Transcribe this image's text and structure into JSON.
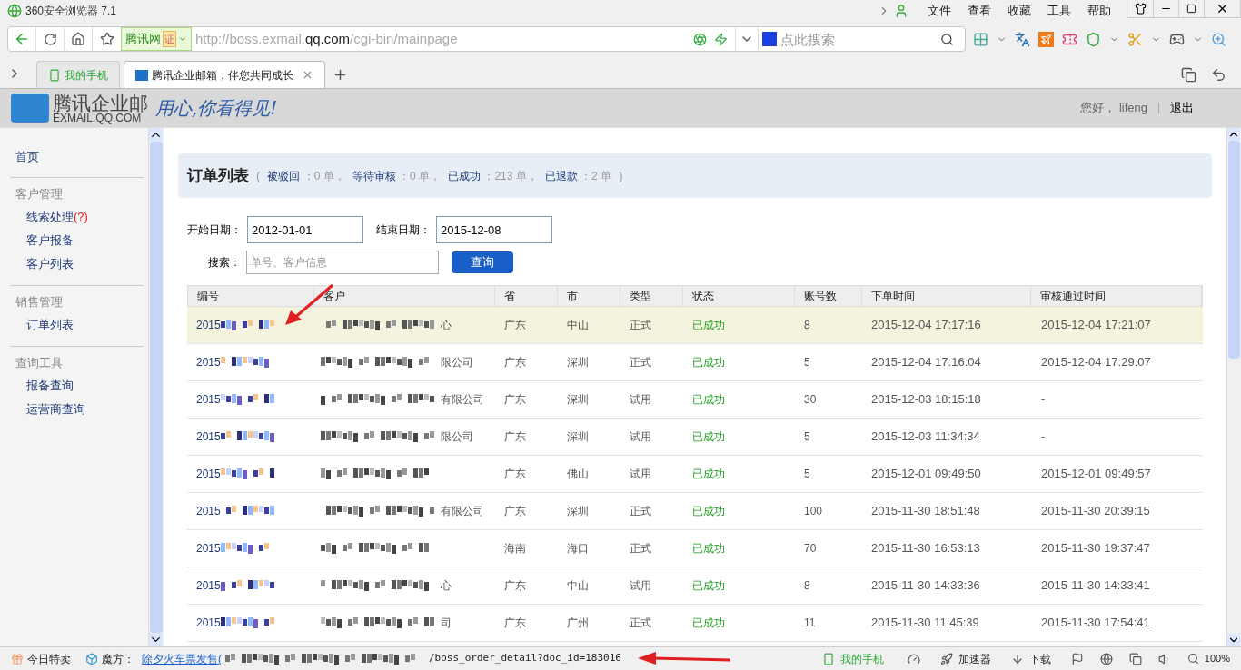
{
  "browser": {
    "title": "360安全浏览器 7.1",
    "menu": [
      "文件",
      "查看",
      "收藏",
      "工具",
      "帮助"
    ],
    "identity": {
      "name": "腾讯网",
      "badge": "证"
    },
    "url": {
      "prefix": "http://boss.exmail.",
      "domain": "qq.com",
      "path": "/cgi-bin/mainpage"
    },
    "search_placeholder": "点此搜索",
    "tabs": [
      {
        "label": "我的手机",
        "kind": "phone",
        "selected": false
      },
      {
        "label": "腾讯企业邮箱，伴您共同成长",
        "kind": "page",
        "selected": true
      }
    ]
  },
  "header": {
    "logo_name": "腾讯企业邮",
    "logo_domain": "EXMAIL.QQ.COM",
    "slogan": "用心,你看得见!",
    "greeting": "您好，",
    "user": "lifeng",
    "logout": "退出"
  },
  "sidebar": {
    "home": "首页",
    "groups": [
      {
        "title": "客户管理",
        "items": [
          {
            "label": "线索处理",
            "badge": "(?)"
          },
          {
            "label": "客户报备"
          },
          {
            "label": "客户列表"
          }
        ]
      },
      {
        "title": "销售管理",
        "items": [
          {
            "label": "订单列表"
          }
        ]
      },
      {
        "title": "查询工具",
        "items": [
          {
            "label": "报备查询"
          },
          {
            "label": "运营商查询"
          }
        ]
      }
    ]
  },
  "summary": {
    "title": "订单列表",
    "open": "(",
    "close": ")",
    "stats": [
      {
        "label": "被驳回",
        "value": "：0 单，"
      },
      {
        "label": "等待审核",
        "value": "：0 单，"
      },
      {
        "label": "已成功",
        "value": "：213 单，"
      },
      {
        "label": "已退款",
        "value": "：2 单"
      }
    ]
  },
  "filters": {
    "start_label": "开始日期：",
    "start_value": "2012-01-01",
    "end_label": "结束日期：",
    "end_value": "2015-12-08",
    "search_label": "搜索：",
    "search_placeholder": "单号、客户信息",
    "query_button": "查询"
  },
  "table": {
    "columns": [
      "编号",
      "客户",
      "省",
      "市",
      "类型",
      "状态",
      "账号数",
      "下单时间",
      "审核通过时间"
    ],
    "rows": [
      {
        "order_no": "2015",
        "customer": "心",
        "province": "广东",
        "city": "中山",
        "type": "正式",
        "status": "已成功",
        "accounts": "8",
        "order_time": "2015-12-04 17:17:16",
        "approved_time": "2015-12-04 17:21:07",
        "selected": true
      },
      {
        "order_no": "2015",
        "customer": "限公司",
        "province": "广东",
        "city": "深圳",
        "type": "正式",
        "status": "已成功",
        "accounts": "5",
        "order_time": "2015-12-04 17:16:04",
        "approved_time": "2015-12-04 17:29:07",
        "selected": false
      },
      {
        "order_no": "2015",
        "customer": "有限公司",
        "province": "广东",
        "city": "深圳",
        "type": "试用",
        "status": "已成功",
        "accounts": "30",
        "order_time": "2015-12-03 18:15:18",
        "approved_time": "-",
        "selected": false
      },
      {
        "order_no": "2015",
        "customer": "限公司",
        "province": "广东",
        "city": "深圳",
        "type": "试用",
        "status": "已成功",
        "accounts": "5",
        "order_time": "2015-12-03 11:34:34",
        "approved_time": "-",
        "selected": false
      },
      {
        "order_no": "2015",
        "province": "广东",
        "city": "佛山",
        "type": "试用",
        "status": "已成功",
        "accounts": "5",
        "order_time": "2015-12-01 09:49:50",
        "approved_time": "2015-12-01 09:49:57",
        "selected": false
      },
      {
        "order_no": "2015",
        "customer": "有限公司",
        "province": "广东",
        "city": "深圳",
        "type": "正式",
        "status": "已成功",
        "accounts": "100",
        "order_time": "2015-11-30 18:51:48",
        "approved_time": "2015-11-30 20:39:15",
        "selected": false
      },
      {
        "order_no": "2015",
        "province": "海南",
        "city": "海口",
        "type": "正式",
        "status": "已成功",
        "accounts": "70",
        "order_time": "2015-11-30 16:53:13",
        "approved_time": "2015-11-30 19:37:47",
        "selected": false
      },
      {
        "order_no": "2015",
        "customer": "心",
        "province": "广东",
        "city": "中山",
        "type": "试用",
        "status": "已成功",
        "accounts": "8",
        "order_time": "2015-11-30 14:33:36",
        "approved_time": "2015-11-30 14:33:41",
        "selected": false
      },
      {
        "order_no": "2015",
        "customer": "司",
        "province": "广东",
        "city": "广州",
        "type": "正式",
        "status": "已成功",
        "accounts": "11",
        "order_time": "2015-11-30 11:45:39",
        "approved_time": "2015-11-30 17:54:41",
        "selected": false
      }
    ]
  },
  "status_bar": {
    "deals": "今日特卖",
    "cube": "魔方：",
    "link": "除夕火车票发售(",
    "url_tail": "/boss_order_detail?doc_id=183016",
    "phone": "我的手机",
    "accelerator": "加速器",
    "download": "下载",
    "zoom": "100%"
  }
}
